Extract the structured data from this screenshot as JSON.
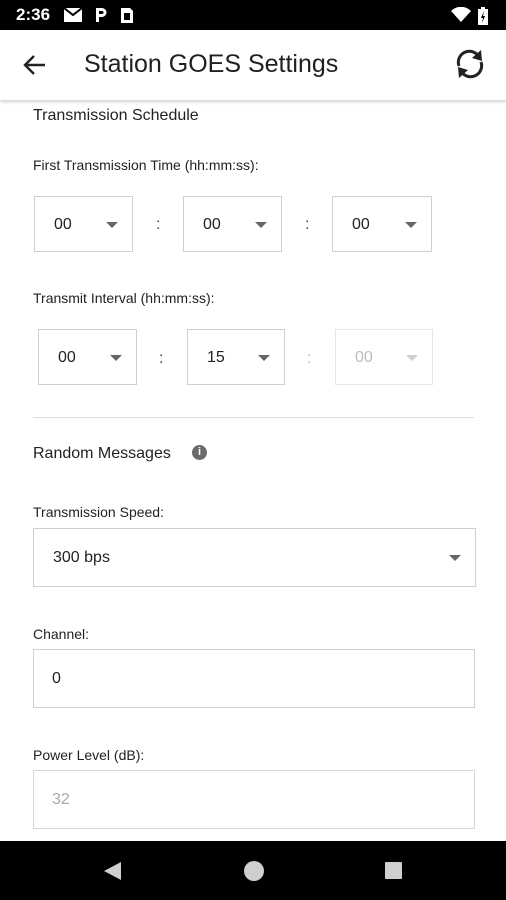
{
  "status_bar": {
    "time": "2:36",
    "icons": [
      "gmail-icon",
      "parking-icon",
      "sim-card-icon",
      "wifi-icon",
      "battery-icon"
    ]
  },
  "app_bar": {
    "title": "Station GOES Settings",
    "back_icon": "arrow-back-icon",
    "sync_icon": "sync-icon"
  },
  "schedule": {
    "section_title": "Transmission Schedule",
    "first_time": {
      "label": "First Transmission Time (hh:mm:ss):",
      "hh": "00",
      "mm": "00",
      "ss": "00",
      "separator": ":"
    },
    "interval": {
      "label": "Transmit Interval (hh:mm:ss):",
      "hh": "00",
      "mm": "15",
      "ss": "00",
      "separator": ":"
    }
  },
  "random_messages": {
    "section_title": "Random Messages",
    "info_icon": "info-icon",
    "info_glyph": "i",
    "speed": {
      "label": "Transmission Speed:",
      "value": "300 bps"
    },
    "channel": {
      "label": "Channel:",
      "value": "0"
    },
    "power": {
      "label": "Power Level (dB):",
      "value": "32"
    }
  },
  "nav_bar": {
    "buttons": [
      "back-triangle-icon",
      "home-circle-icon",
      "recents-square-icon"
    ]
  },
  "colors": {
    "accent_dark": "#212121",
    "border": "#cfcfcf",
    "disabled_text": "#aaaaaa",
    "system_bar": "#000000"
  }
}
